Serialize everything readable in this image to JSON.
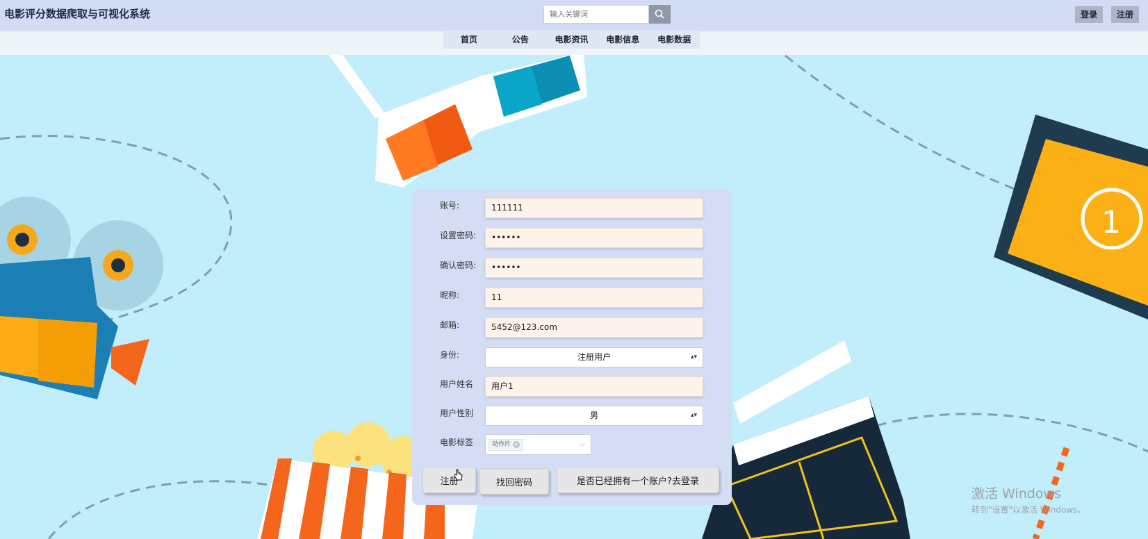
{
  "header": {
    "title": "电影评分数据爬取与可视化系统",
    "search_placeholder": "输入关键词",
    "login_label": "登录",
    "register_label": "注册"
  },
  "nav": {
    "items": [
      "首页",
      "公告",
      "电影资讯",
      "电影信息",
      "电影数据"
    ]
  },
  "form": {
    "account_label": "账号:",
    "account_value": "111111",
    "password_label": "设置密码:",
    "password_value": "••••••",
    "confirm_label": "确认密码:",
    "confirm_value": "••••••",
    "nickname_label": "昵称:",
    "nickname_value": "11",
    "email_label": "邮箱:",
    "email_value": "5452@123.com",
    "identity_label": "身份:",
    "identity_value": "注册用户",
    "username_label": "用户姓名",
    "username_value": "用户1",
    "gender_label": "用户性别",
    "gender_value": "男",
    "tags_label": "电影标签",
    "tag_selected": "动作片"
  },
  "buttons": {
    "register": "注册",
    "find_password": "找回密码",
    "go_login": "是否已经拥有一个账户?去登录"
  },
  "watermark": {
    "line1": "激活 Windows",
    "line2": "转到\"设置\"以激活 Windows。"
  },
  "colors": {
    "background": "#c1eefa",
    "header": "#d3dcf5",
    "card": "#d4ddf4",
    "field": "#fdf3ea"
  }
}
